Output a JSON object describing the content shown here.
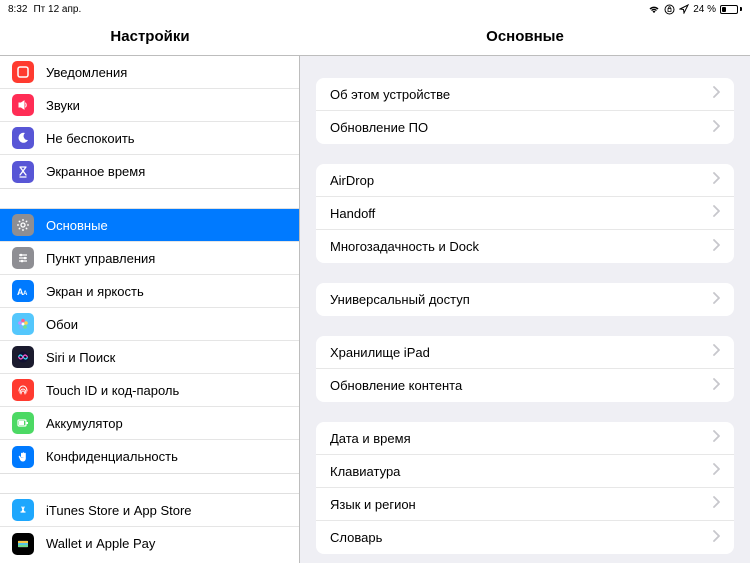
{
  "status": {
    "time": "8:32",
    "date": "Пт 12 апр.",
    "battery_pct": "24 %"
  },
  "titles": {
    "sidebar": "Настройки",
    "detail": "Основные"
  },
  "sidebar": {
    "groups": [
      {
        "items": [
          {
            "key": "notifications",
            "label": "Уведомления",
            "icon_bg": "#ff3b30",
            "selected": false
          },
          {
            "key": "sounds",
            "label": "Звуки",
            "icon_bg": "#ff2d55",
            "selected": false
          },
          {
            "key": "dnd",
            "label": "Не беспокоить",
            "icon_bg": "#5856d6",
            "selected": false
          },
          {
            "key": "screentime",
            "label": "Экранное время",
            "icon_bg": "#5856d6",
            "selected": false
          }
        ]
      },
      {
        "items": [
          {
            "key": "general",
            "label": "Основные",
            "icon_bg": "#8e8e93",
            "selected": true
          },
          {
            "key": "controlcenter",
            "label": "Пункт управления",
            "icon_bg": "#8e8e93",
            "selected": false
          },
          {
            "key": "display",
            "label": "Экран и яркость",
            "icon_bg": "#007aff",
            "selected": false
          },
          {
            "key": "wallpaper",
            "label": "Обои",
            "icon_bg": "#54c7fc",
            "selected": false
          },
          {
            "key": "siri",
            "label": "Siri и Поиск",
            "icon_bg": "#1b1b2e",
            "selected": false
          },
          {
            "key": "touchid",
            "label": "Touch ID и код-пароль",
            "icon_bg": "#ff3b30",
            "selected": false
          },
          {
            "key": "battery",
            "label": "Аккумулятор",
            "icon_bg": "#4cd964",
            "selected": false
          },
          {
            "key": "privacy",
            "label": "Конфиденциальность",
            "icon_bg": "#007aff",
            "selected": false
          }
        ]
      },
      {
        "items": [
          {
            "key": "itunes",
            "label": "iTunes Store и App Store",
            "icon_bg": "#1ea7fd",
            "selected": false
          },
          {
            "key": "wallet",
            "label": "Wallet и Apple Pay",
            "icon_bg": "#000000",
            "selected": false
          }
        ]
      }
    ]
  },
  "detail": {
    "groups": [
      {
        "items": [
          {
            "label": "Об этом устройстве"
          },
          {
            "label": "Обновление ПО"
          }
        ]
      },
      {
        "items": [
          {
            "label": "AirDrop"
          },
          {
            "label": "Handoff"
          },
          {
            "label": "Многозадачность и Dock"
          }
        ]
      },
      {
        "items": [
          {
            "label": "Универсальный доступ"
          }
        ]
      },
      {
        "items": [
          {
            "label": "Хранилище iPad"
          },
          {
            "label": "Обновление контента"
          }
        ]
      },
      {
        "items": [
          {
            "label": "Дата и время"
          },
          {
            "label": "Клавиатура"
          },
          {
            "label": "Язык и регион"
          },
          {
            "label": "Словарь"
          }
        ]
      }
    ]
  },
  "icons": {
    "notifications": "notifications",
    "sounds": "sounds",
    "dnd": "moon",
    "screentime": "hourglass",
    "general": "gear",
    "controlcenter": "sliders",
    "display": "textsize",
    "wallpaper": "flower",
    "siri": "siri",
    "touchid": "fingerprint",
    "battery": "battery",
    "privacy": "hand",
    "itunes": "appstore",
    "wallet": "wallet"
  }
}
